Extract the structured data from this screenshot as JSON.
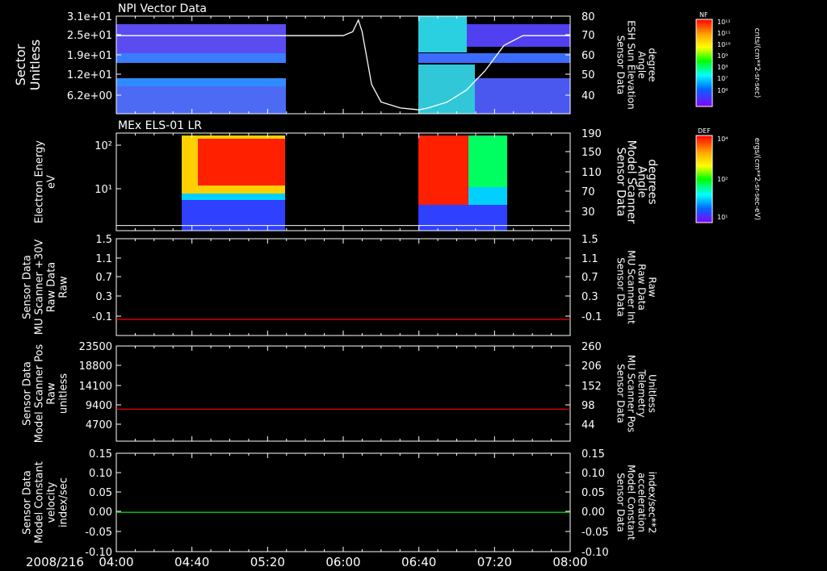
{
  "colors": {
    "white": "#ffffff",
    "red": "#ff0000",
    "green": "#00ff00",
    "bg": "#000000"
  },
  "time_axis": {
    "date_label": "2008/216",
    "ticks": [
      "04:00",
      "04:40",
      "05:20",
      "06:00",
      "06:40",
      "07:20",
      "08:00"
    ],
    "minutes": [
      0,
      40,
      80,
      120,
      160,
      200,
      240
    ]
  },
  "chart_data": [
    {
      "type": "heatmap",
      "title": "NPI Vector Data",
      "ylabel_left": [
        "Sector",
        "Unitless"
      ],
      "yticks_left": [
        "3.1e+01",
        "2.5e+01",
        "1.9e+01",
        "1.2e+01",
        "6.2e+00"
      ],
      "ylabel_right": [
        "Sensor Data",
        "ESH Sun Elevation",
        "Angle",
        "degree"
      ],
      "yticks_right": [
        "80",
        "70",
        "60",
        "50",
        "40"
      ],
      "right_ylim": [
        30,
        80
      ],
      "data_gaps_minutes": [
        [
          80,
          160
        ]
      ],
      "overlay_line": {
        "color": "#ffffff",
        "x_minutes": [
          0,
          80,
          120,
          125,
          128,
          130,
          135,
          140,
          150,
          160,
          165,
          175,
          185,
          195,
          205,
          215,
          240
        ],
        "y": [
          70,
          70,
          70,
          72,
          78,
          72,
          45,
          36,
          33,
          32,
          33,
          36,
          42,
          52,
          65,
          70,
          70
        ]
      },
      "colorbar": {
        "label": "NF",
        "units": "cnts/(cm**2-sr-sec)",
        "ticks": [
          "10¹²",
          "10¹¹",
          "10¹⁰",
          "10⁹",
          "10⁸",
          "10⁷",
          "10⁶"
        ]
      }
    },
    {
      "type": "heatmap",
      "title": "MEx ELS-01 LR",
      "ylabel_left": [
        "Electron Energy",
        "eV"
      ],
      "yticks_left": [
        "10²",
        "10¹"
      ],
      "ylabel_right": [
        "Sensor Data",
        "Model Scanner",
        "Angle",
        "degrees"
      ],
      "yticks_right": [
        "190",
        "150",
        "110",
        "70",
        "30"
      ],
      "right_ylim": [
        0,
        190
      ],
      "data_intervals_minutes": [
        [
          30,
          80
        ],
        [
          160,
          205
        ]
      ],
      "overlay_line": {
        "color": "#ffffff",
        "y_constant": 10
      },
      "colorbar": {
        "label": "DEF",
        "units": "ergs/(cm**2-sr-sec-eV)",
        "ticks": [
          "10⁴",
          "10²",
          "10¹"
        ]
      }
    },
    {
      "type": "line",
      "ylabel_left": [
        "Sensor Data",
        "MU Scanner +30V",
        "Raw Data",
        "Raw"
      ],
      "yticks_left": [
        "1.5",
        "1.1",
        "0.7",
        "0.3",
        "-0.1"
      ],
      "ylabel_right": [
        "Sensor Data",
        "MU Scanner Int",
        "Raw Data",
        "Raw"
      ],
      "yticks_right": [
        "1.5",
        "1.1",
        "0.7",
        "0.3",
        "-0.1"
      ],
      "ylim": [
        -0.3,
        1.5
      ],
      "series": [
        {
          "color": "#ff0000",
          "x_minutes": [
            0,
            240
          ],
          "y": [
            0,
            0
          ]
        }
      ]
    },
    {
      "type": "line",
      "ylabel_left": [
        "Sensor Data",
        "Model Scanner Pos",
        "Raw",
        "unitless"
      ],
      "yticks_left": [
        "23500",
        "18800",
        "14100",
        "9400",
        "4700"
      ],
      "ylabel_right": [
        "Sensor Data",
        "MU Scanner Pos",
        "Telemetry",
        "Unitless"
      ],
      "yticks_right": [
        "260",
        "206",
        "152",
        "98",
        "44"
      ],
      "ylim": [
        0,
        23500
      ],
      "series": [
        {
          "color": "#ff0000",
          "x_minutes": [
            0,
            240
          ],
          "y": [
            7900,
            7900
          ]
        }
      ]
    },
    {
      "type": "line",
      "ylabel_left": [
        "Sensor Data",
        "Model Constant",
        "velocity",
        "index/sec"
      ],
      "yticks_left": [
        "0.15",
        "0.10",
        "0.05",
        "0.00",
        "-0.05",
        "-0.10"
      ],
      "ylabel_right": [
        "Sensor Data",
        "Model Constant",
        "acceleration",
        "index/sec**2"
      ],
      "yticks_right": [
        "0.15",
        "0.10",
        "0.05",
        "0.00",
        "-0.05",
        "-0.10"
      ],
      "ylim": [
        -0.1,
        0.15
      ],
      "series": [
        {
          "color": "#00ff00",
          "x_minutes": [
            0,
            240
          ],
          "y": [
            0,
            0
          ]
        }
      ]
    }
  ]
}
